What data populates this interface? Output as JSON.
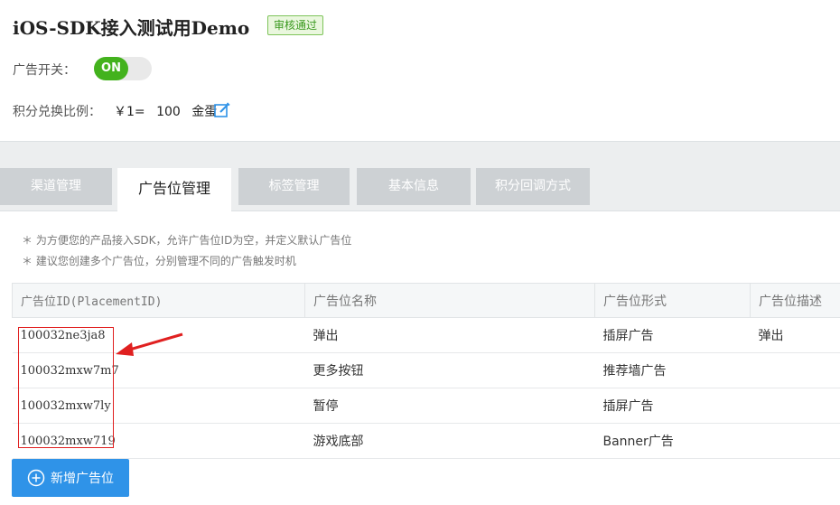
{
  "app": {
    "title": "iOS-SDK接入测试用Demo",
    "status_badge": "审核通过"
  },
  "settings": {
    "ad_switch_label": "广告开关：",
    "ad_switch_state": "ON",
    "exchange_label": "积分兑换比例：",
    "exchange_currency": "￥1=",
    "exchange_amount": "100",
    "exchange_unit": "金蛋",
    "edit_icon": "edit-icon"
  },
  "tabs": [
    {
      "label": "渠道管理",
      "active": false
    },
    {
      "label": "广告位管理",
      "active": true
    },
    {
      "label": "标签管理",
      "active": false
    },
    {
      "label": "基本信息",
      "active": false
    },
    {
      "label": "积分回调方式",
      "active": false
    }
  ],
  "notes": [
    "＊ 为方便您的产品接入SDK，允许广告位ID为空，并定义默认广告位",
    "＊ 建议您创建多个广告位，分别管理不同的广告触发时机"
  ],
  "table": {
    "headers": [
      "广告位ID(PlacementID)",
      "广告位名称",
      "广告位形式",
      "广告位描述"
    ],
    "rows": [
      {
        "id": "100032ne3ja8",
        "name": "弹出",
        "type": "插屏广告",
        "desc": "弹出"
      },
      {
        "id": "100032mxw7m7",
        "name": "更多按钮",
        "type": "推荐墙广告",
        "desc": ""
      },
      {
        "id": "100032mxw7ly",
        "name": "暂停",
        "type": "插屏广告",
        "desc": ""
      },
      {
        "id": "100032mxw719",
        "name": "游戏底部",
        "type": "Banner广告",
        "desc": ""
      }
    ]
  },
  "add_button": {
    "label": "新增广告位",
    "icon": "plus-circle-icon"
  },
  "colors": {
    "accent": "#2f93e8",
    "on_green": "#43b21d",
    "highlight_red": "#e02020"
  }
}
